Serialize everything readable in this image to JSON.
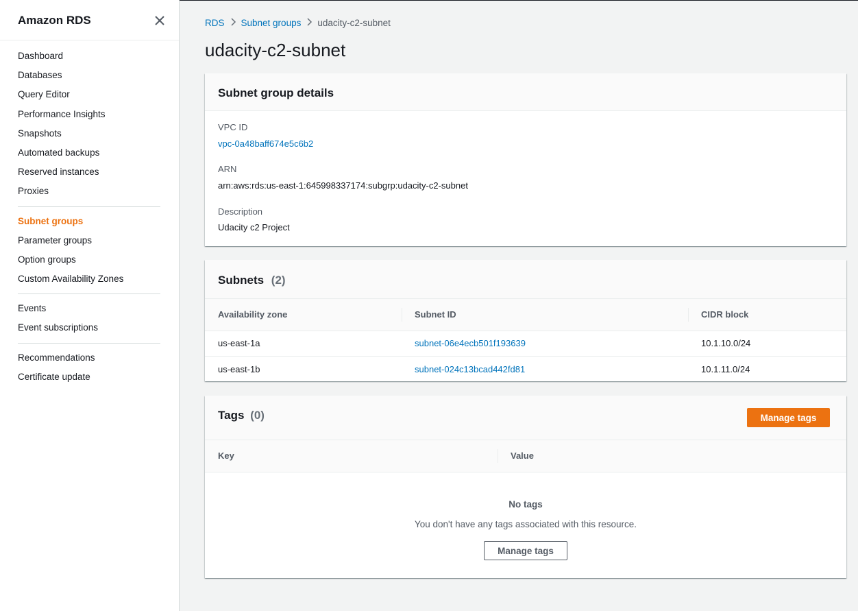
{
  "sidebar": {
    "title": "Amazon RDS",
    "groups": [
      [
        "Dashboard",
        "Databases",
        "Query Editor",
        "Performance Insights",
        "Snapshots",
        "Automated backups",
        "Reserved instances",
        "Proxies"
      ],
      [
        "Subnet groups",
        "Parameter groups",
        "Option groups",
        "Custom Availability Zones"
      ],
      [
        "Events",
        "Event subscriptions"
      ],
      [
        "Recommendations",
        "Certificate update"
      ]
    ],
    "active_item": "Subnet groups"
  },
  "breadcrumb": {
    "items": [
      "RDS",
      "Subnet groups"
    ],
    "current": "udacity-c2-subnet"
  },
  "page_title": "udacity-c2-subnet",
  "details": {
    "title": "Subnet group details",
    "vpc_label": "VPC ID",
    "vpc_value": "vpc-0a48baff674e5c6b2",
    "arn_label": "ARN",
    "arn_value": "arn:aws:rds:us-east-1:645998337174:subgrp:udacity-c2-subnet",
    "description_label": "Description",
    "description_value": "Udacity c2 Project"
  },
  "subnets": {
    "title": "Subnets",
    "count": "(2)",
    "columns": [
      "Availability zone",
      "Subnet ID",
      "CIDR block"
    ],
    "rows": [
      {
        "az": "us-east-1a",
        "subnet_id": "subnet-06e4ecb501f193639",
        "cidr": "10.1.10.0/24"
      },
      {
        "az": "us-east-1b",
        "subnet_id": "subnet-024c13bcad442fd81",
        "cidr": "10.1.11.0/24"
      }
    ]
  },
  "tags": {
    "title": "Tags",
    "count": "(0)",
    "manage_button": "Manage tags",
    "columns": [
      "Key",
      "Value"
    ],
    "empty_title": "No tags",
    "empty_text": "You don't have any tags associated with this resource.",
    "empty_button": "Manage tags"
  },
  "colors": {
    "accent": "#ec7211",
    "link": "#0073bb"
  }
}
